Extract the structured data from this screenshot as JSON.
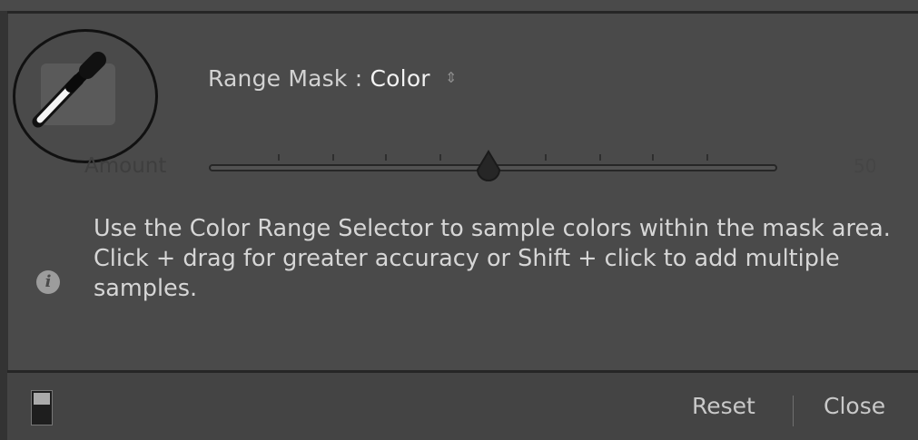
{
  "range_mask": {
    "label": "Range Mask :",
    "value": "Color",
    "stepper_glyph": "⇕"
  },
  "amount": {
    "label": "Amount",
    "value": "50",
    "fraction": 0.5
  },
  "info": {
    "icon_glyph": "i",
    "text": "Use the Color Range Selector to sample colors within the mask area. Click + drag for greater accuracy or Shift + click to add multiple samples."
  },
  "footer": {
    "reset_label": "Reset",
    "close_label": "Close"
  },
  "icons": {
    "tool": "eyedropper-icon",
    "info": "info-icon",
    "toggle": "panel-toggle-icon"
  }
}
